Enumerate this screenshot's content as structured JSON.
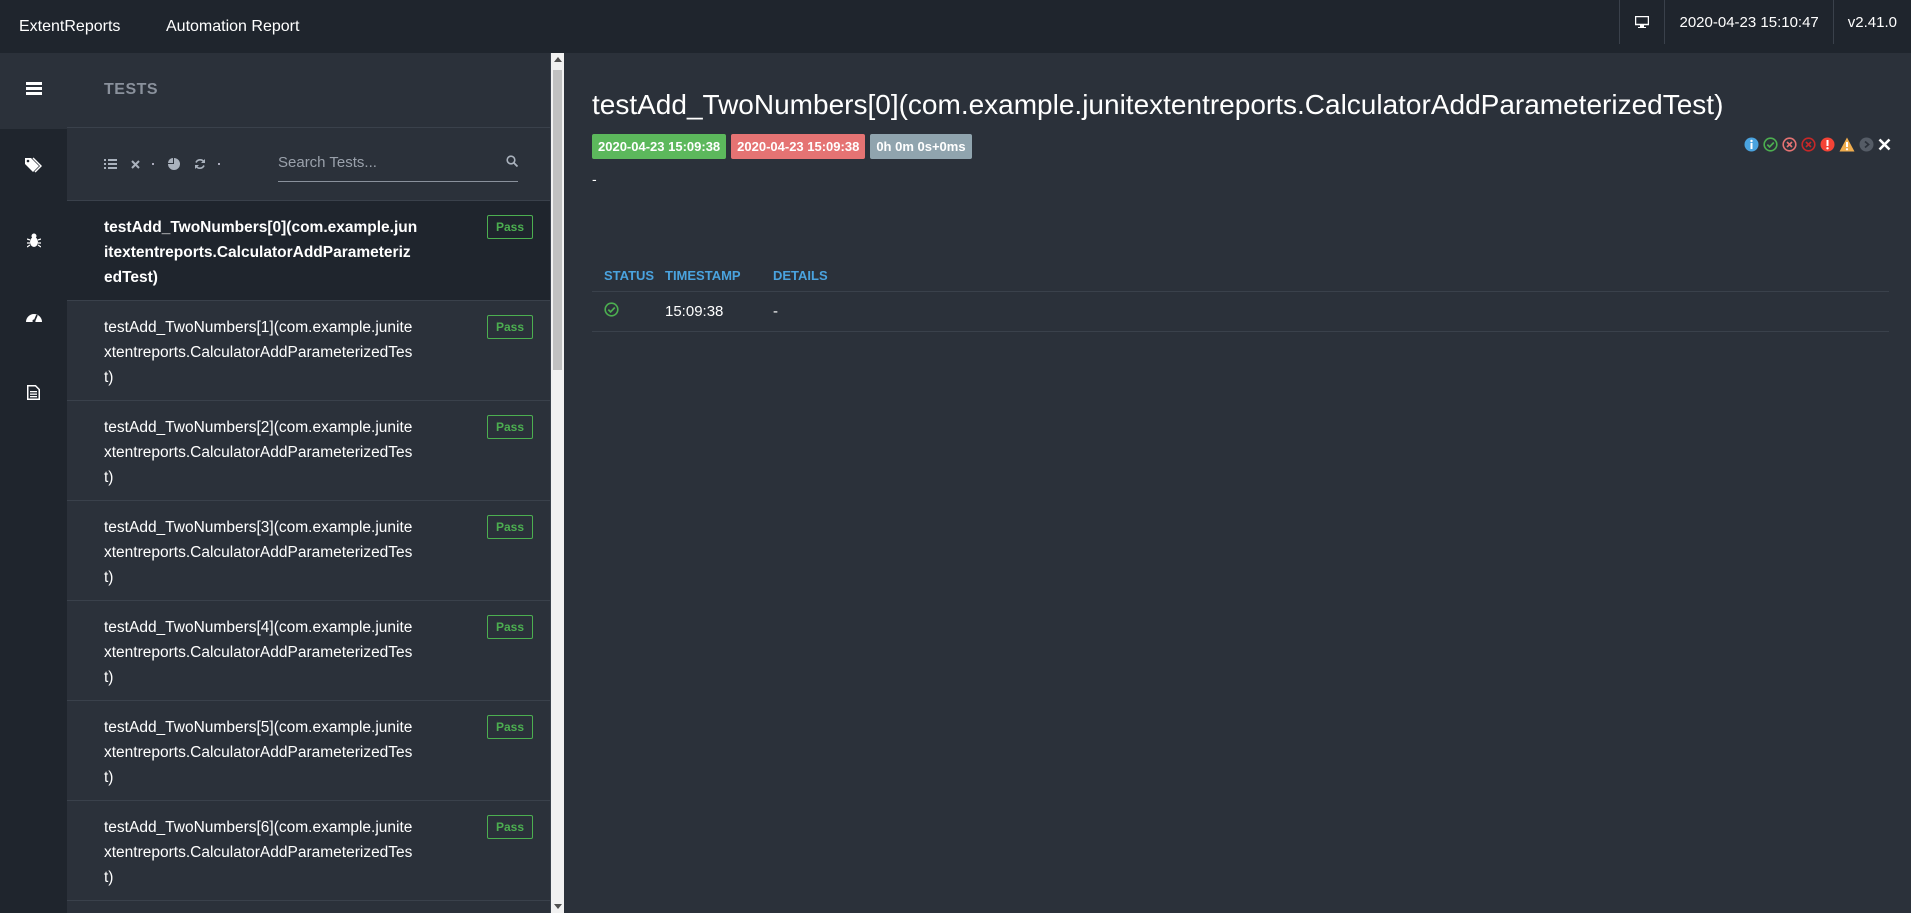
{
  "topbar": {
    "brand": "ExtentReports",
    "report_name": "Automation Report",
    "timestamp": "2020-04-23 15:10:47",
    "version": "v2.41.0"
  },
  "sidebar": {
    "items": [
      {
        "icon": "list-icon",
        "active": true
      },
      {
        "icon": "tags-icon"
      },
      {
        "icon": "bug-icon"
      },
      {
        "icon": "dashboard-icon"
      },
      {
        "icon": "document-icon"
      }
    ]
  },
  "tests_panel": {
    "title": "TESTS",
    "search_placeholder": "Search Tests...",
    "tests": [
      {
        "name": "testAdd_TwoNumbers[0](com.example.junitextentreports.CalculatorAddParameterizedTest)",
        "status": "Pass"
      },
      {
        "name": "testAdd_TwoNumbers[1](com.example.junitextentreports.CalculatorAddParameterizedTest)",
        "status": "Pass"
      },
      {
        "name": "testAdd_TwoNumbers[2](com.example.junitextentreports.CalculatorAddParameterizedTest)",
        "status": "Pass"
      },
      {
        "name": "testAdd_TwoNumbers[3](com.example.junitextentreports.CalculatorAddParameterizedTest)",
        "status": "Pass"
      },
      {
        "name": "testAdd_TwoNumbers[4](com.example.junitextentreports.CalculatorAddParameterizedTest)",
        "status": "Pass"
      },
      {
        "name": "testAdd_TwoNumbers[5](com.example.junitextentreports.CalculatorAddParameterizedTest)",
        "status": "Pass"
      },
      {
        "name": "testAdd_TwoNumbers[6](com.example.junitextentreports.CalculatorAddParameterizedTest)",
        "status": "Pass"
      }
    ]
  },
  "detail": {
    "title": "testAdd_TwoNumbers[0](com.example.junitextentreports.CalculatorAddParameterizedTest)",
    "start_time": "2020-04-23 15:09:38",
    "end_time": "2020-04-23 15:09:38",
    "duration": "0h 0m 0s+0ms",
    "description": "-",
    "log": {
      "headers": [
        "STATUS",
        "TIMESTAMP",
        "DETAILS"
      ],
      "rows": [
        {
          "status": "pass",
          "timestamp": "15:09:38",
          "details": "-"
        }
      ]
    }
  },
  "colors": {
    "pass": "#4caf50",
    "fail": "#e57373",
    "info": "#4aa3df",
    "warning": "#f0ad4e"
  }
}
